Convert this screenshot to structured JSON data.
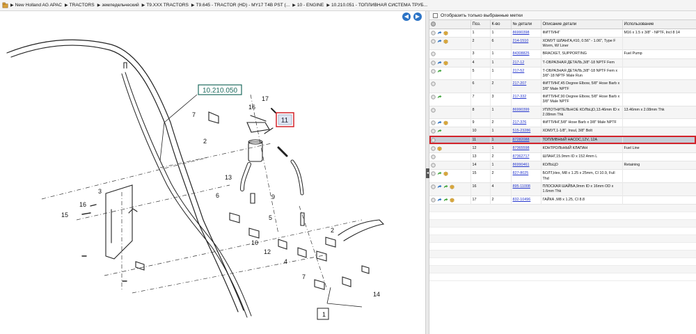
{
  "breadcrumb": [
    {
      "label": "New Holland AG APAC"
    },
    {
      "label": "TRACTORS"
    },
    {
      "label": "земледельческий"
    },
    {
      "label": "T9.XXX TRACTORS"
    },
    {
      "label": "T9.645 - TRACTOR (HD) - MY17 T4B PST (..."
    },
    {
      "label": "10 - ENGINE"
    },
    {
      "label": "10.210.051 - ТОПЛИВНАЯ СИСТЕМА ТРУБ..."
    }
  ],
  "diagram": {
    "ref_label": "10.210.050",
    "selected_callout": "11",
    "callouts": [
      "1",
      "2",
      "2",
      "3",
      "4",
      "5",
      "6",
      "7",
      "7",
      "9",
      "10",
      "12",
      "13",
      "14",
      "15",
      "16",
      "16",
      "17"
    ]
  },
  "filter": {
    "label": "Отобразить только выбранные метки",
    "checked": false
  },
  "table": {
    "columns": [
      "Поз.",
      "К-во",
      "№ детали",
      "Описание детали",
      "Использование"
    ],
    "rows": [
      {
        "icons": [
          "info",
          "arrow",
          "box"
        ],
        "pos": "1",
        "qty": "1",
        "part": "86990398",
        "desc": "ФИТТИНГ",
        "usage": "M16 x 1.5 x 3/8\" - NPTF, Incl 8 14"
      },
      {
        "icons": [
          "info",
          "arrow",
          "box"
        ],
        "pos": "2",
        "qty": "6",
        "part": "214-1510",
        "desc": "ХОМУТ ШЛАНГА,#10, 0.56\" - 1.06\", Type F Worm, W/ Liner",
        "usage": ""
      },
      {
        "icons": [
          "info"
        ],
        "pos": "3",
        "qty": "1",
        "part": "84308825",
        "desc": "BRACKET, SUPPORTING",
        "usage": "Fuel Pump"
      },
      {
        "icons": [
          "info",
          "arrow",
          "box"
        ],
        "pos": "4",
        "qty": "1",
        "part": "217-12",
        "desc": "Т-ОБРАЗНАЯ ДЕТАЛЬ,3/8\"-18 NPTF Fem",
        "usage": ""
      },
      {
        "icons": [
          "info",
          "garrow"
        ],
        "pos": "5",
        "qty": "1",
        "part": "217-52",
        "desc": "Т-ОБРАЗНАЯ ДЕТАЛЬ,3/8\"-18 NPTF Fem x 3/8\"-18 NPTF Male Run",
        "usage": ""
      },
      {
        "icons": [
          "info"
        ],
        "pos": "6",
        "qty": "2",
        "part": "217-207",
        "desc": "ФИТТИНГ,45 Degree Elbow, 5/8\" Hose Barb x 3/8\" Male NPTF",
        "usage": ""
      },
      {
        "icons": [
          "info",
          "garrow"
        ],
        "pos": "7",
        "qty": "3",
        "part": "217-332",
        "desc": "ФИТТИНГ,90 Degree Elbow, 5/8\" Hose Barb x 3/8\" Male NPTF",
        "usage": ""
      },
      {
        "icons": [
          "info"
        ],
        "pos": "8",
        "qty": "1",
        "part": "86990399",
        "desc": "УПЛОТНИТЕЛЬНОЕ КОЛЬЦО,13.46mm ID x 2.08mm Thk",
        "usage": "13.46mm x 2.08mm Thk"
      },
      {
        "icons": [
          "info",
          "arrow",
          "box"
        ],
        "pos": "9",
        "qty": "2",
        "part": "217-376",
        "desc": "ФИТТИНГ,5/8\" Hose Barb x 3/8\" Male NPTF",
        "usage": ""
      },
      {
        "icons": [
          "info",
          "garrow"
        ],
        "pos": "10",
        "qty": "1",
        "part": "515-23286",
        "desc": "ХОМУТ,1-1/8\", Insul, 3/8\" Bolt",
        "usage": ""
      },
      {
        "icons": [
          "info"
        ],
        "pos": "11",
        "qty": "1",
        "part": "87282088",
        "desc": "ТОПЛИВНЫЙ НАСОС,12V, 12A",
        "usage": "",
        "selected": true
      },
      {
        "icons": [
          "info",
          "box"
        ],
        "pos": "12",
        "qty": "1",
        "part": "87365598",
        "desc": "КОНТРОЛЬНЫЙ КЛАПАН",
        "usage": "Fuel Line"
      },
      {
        "icons": [
          "info"
        ],
        "pos": "13",
        "qty": "2",
        "part": "87362717",
        "desc": "ШЛАНГ,15.9mm ID x 152.4mm L",
        "usage": ""
      },
      {
        "icons": [
          "info"
        ],
        "pos": "14",
        "qty": "1",
        "part": "86990461",
        "desc": "КОЛЬЦО",
        "usage": "Retaining"
      },
      {
        "icons": [
          "info",
          "garrow",
          "box"
        ],
        "pos": "15",
        "qty": "2",
        "part": "827-8025",
        "desc": "БОЛТ,Hex, M8 x 1.25 x 25mm, Cl 10.9, Full Thd",
        "usage": ""
      },
      {
        "icons": [
          "info",
          "arrow",
          "garrow",
          "box"
        ],
        "pos": "16",
        "qty": "4",
        "part": "895-11008",
        "desc": "ПЛОСКАЯ ШАЙБА,9mm ID x 16mm OD x 1.6mm Thk",
        "usage": ""
      },
      {
        "icons": [
          "info",
          "arrow",
          "garrow",
          "box"
        ],
        "pos": "17",
        "qty": "2",
        "part": "832-10496",
        "desc": "ГАЙКА ,M8 x 1.25, Cl 8.8",
        "usage": ""
      }
    ]
  },
  "colors": {
    "link": "#2233cc",
    "selected_outline": "#d3222a",
    "selected_bg": "#c7cdd6",
    "nav_blue": "#2c74c6",
    "ref_box": "#1d6b5e"
  }
}
